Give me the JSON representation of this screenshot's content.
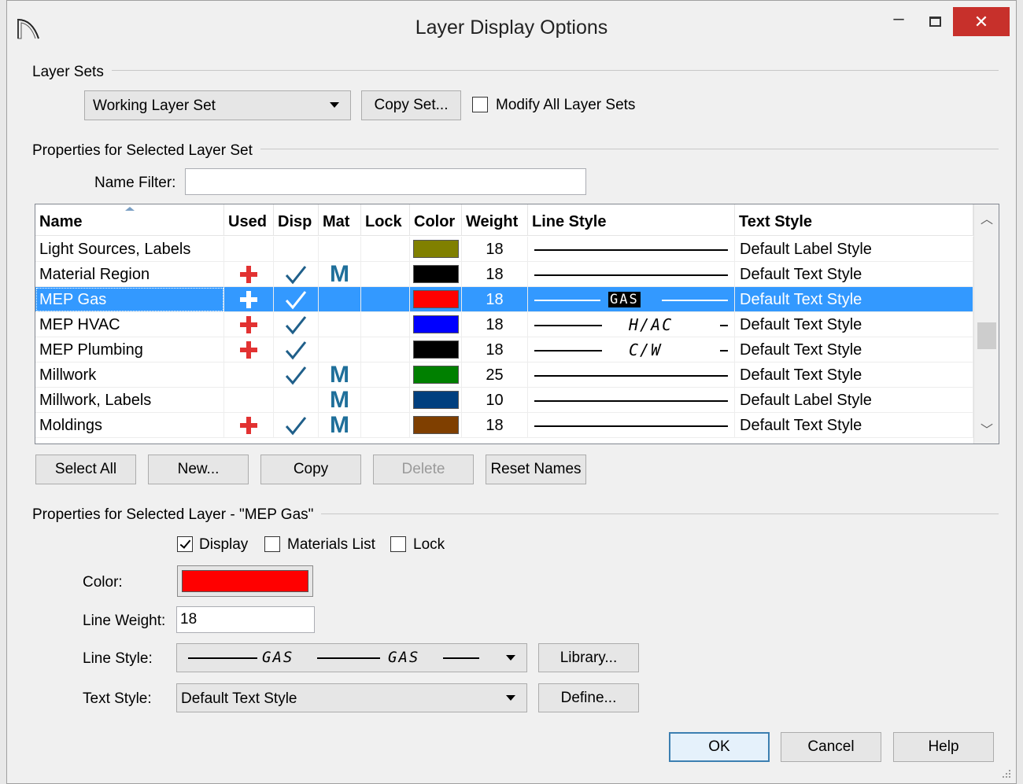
{
  "window": {
    "title": "Layer Display Options"
  },
  "layer_sets": {
    "section_label": "Layer Sets",
    "selected_set": "Working Layer Set",
    "copy_set_label": "Copy Set...",
    "modify_all_label": "Modify All Layer Sets",
    "modify_all_checked": false
  },
  "set_properties": {
    "section_label": "Properties for Selected Layer Set",
    "name_filter_label": "Name Filter:",
    "name_filter_value": ""
  },
  "table": {
    "columns": [
      "Name",
      "Used",
      "Disp",
      "Mat",
      "Lock",
      "Color",
      "Weight",
      "Line Style",
      "Text Style"
    ],
    "rows": [
      {
        "name": "Light Sources, Labels",
        "used": false,
        "disp": false,
        "mat": "",
        "color": "#808000",
        "weight": "18",
        "line_label": "",
        "text_style": "Default Label Style",
        "selected": false
      },
      {
        "name": "Material Region",
        "used": true,
        "disp": true,
        "mat": "M",
        "color": "#000000",
        "weight": "18",
        "line_label": "",
        "text_style": "Default Text Style",
        "selected": false
      },
      {
        "name": "MEP Gas",
        "used": true,
        "disp": true,
        "mat": "",
        "color": "#ff0000",
        "weight": "18",
        "line_label": "GAS",
        "text_style": "Default Text Style",
        "selected": true
      },
      {
        "name": "MEP HVAC",
        "used": true,
        "disp": true,
        "mat": "",
        "color": "#0000ff",
        "weight": "18",
        "line_label": "H/AC",
        "text_style": "Default Text Style",
        "selected": false
      },
      {
        "name": "MEP Plumbing",
        "used": true,
        "disp": true,
        "mat": "",
        "color": "#000000",
        "weight": "18",
        "line_label": "C/W",
        "text_style": "Default Text Style",
        "selected": false
      },
      {
        "name": "Millwork",
        "used": false,
        "disp": true,
        "mat": "M",
        "color": "#008000",
        "weight": "25",
        "line_label": "",
        "text_style": "Default Text Style",
        "selected": false
      },
      {
        "name": "Millwork, Labels",
        "used": false,
        "disp": false,
        "mat": "M",
        "color": "#003f7f",
        "weight": "10",
        "line_label": "",
        "text_style": "Default Label Style",
        "selected": false
      },
      {
        "name": "Moldings",
        "used": true,
        "disp": true,
        "mat": "M",
        "color": "#7f3f00",
        "weight": "18",
        "line_label": "",
        "text_style": "Default Text Style",
        "selected": false
      }
    ]
  },
  "table_buttons": {
    "select_all": "Select All",
    "new": "New...",
    "copy": "Copy",
    "delete": "Delete",
    "reset_names": "Reset Names"
  },
  "layer_properties": {
    "section_label": "Properties for Selected Layer - \"MEP Gas\"",
    "display_label": "Display",
    "display_checked": true,
    "materials_label": "Materials List",
    "materials_checked": false,
    "lock_label": "Lock",
    "lock_checked": false,
    "color_label": "Color:",
    "color_value": "#ff0000",
    "weight_label": "Line Weight:",
    "weight_value": "18",
    "line_style_label": "Line Style:",
    "line_style_text_1": "GAS",
    "line_style_text_2": "GAS",
    "library_label": "Library...",
    "text_style_label": "Text Style:",
    "text_style_value": "Default Text Style",
    "define_label": "Define..."
  },
  "dialog_buttons": {
    "ok": "OK",
    "cancel": "Cancel",
    "help": "Help"
  },
  "icons": {
    "used": "red-plus-icon",
    "disp": "check-icon",
    "mat": "materials-m-icon",
    "accent": "#3399ff"
  }
}
